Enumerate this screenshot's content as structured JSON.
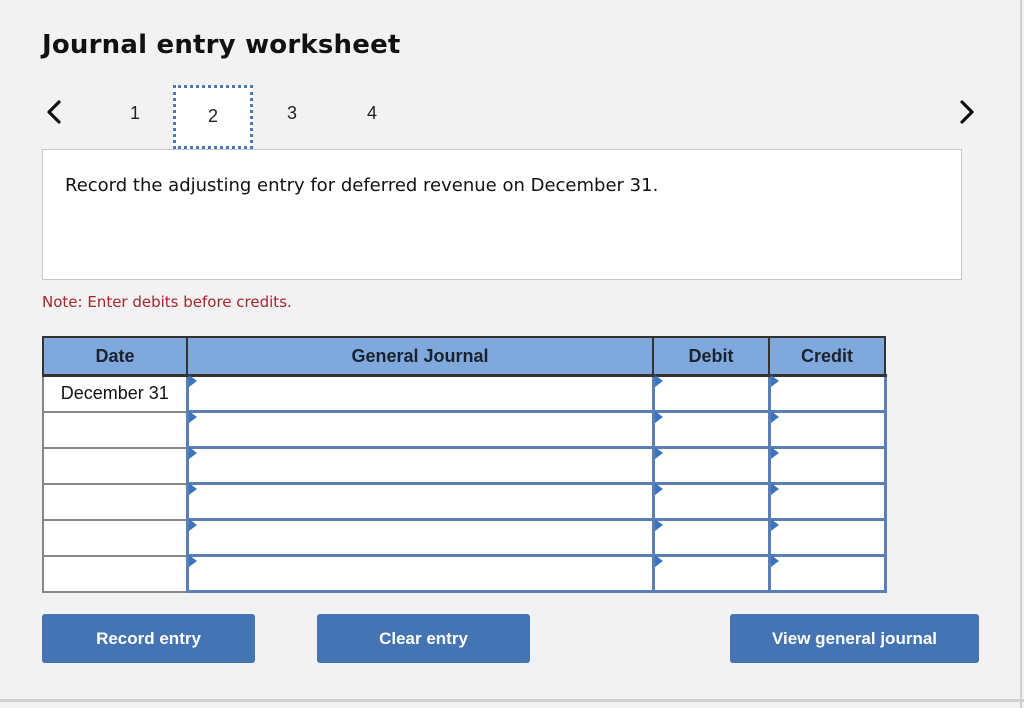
{
  "header": {
    "title": "Journal entry worksheet"
  },
  "pager": {
    "prev_icon": "chevron-left-icon",
    "next_icon": "chevron-right-icon",
    "steps": [
      "1",
      "2",
      "3",
      "4"
    ],
    "active_step": "2"
  },
  "prompt": {
    "text": "Record the adjusting entry for deferred revenue on December 31."
  },
  "note": "Note: Enter debits before credits.",
  "table": {
    "columns": [
      "Date",
      "General Journal",
      "Debit",
      "Credit"
    ],
    "rows": [
      {
        "date": "December 31",
        "account": "",
        "debit": "",
        "credit": ""
      },
      {
        "date": "",
        "account": "",
        "debit": "",
        "credit": ""
      },
      {
        "date": "",
        "account": "",
        "debit": "",
        "credit": ""
      },
      {
        "date": "",
        "account": "",
        "debit": "",
        "credit": ""
      },
      {
        "date": "",
        "account": "",
        "debit": "",
        "credit": ""
      },
      {
        "date": "",
        "account": "",
        "debit": "",
        "credit": ""
      }
    ]
  },
  "buttons": {
    "record": "Record entry",
    "clear": "Clear entry",
    "view": "View general journal"
  },
  "colors": {
    "accent": "#4474b2",
    "header_bg": "#7fa9dc",
    "note_red": "#a3282b",
    "focus_dotted": "#4a78b8"
  }
}
